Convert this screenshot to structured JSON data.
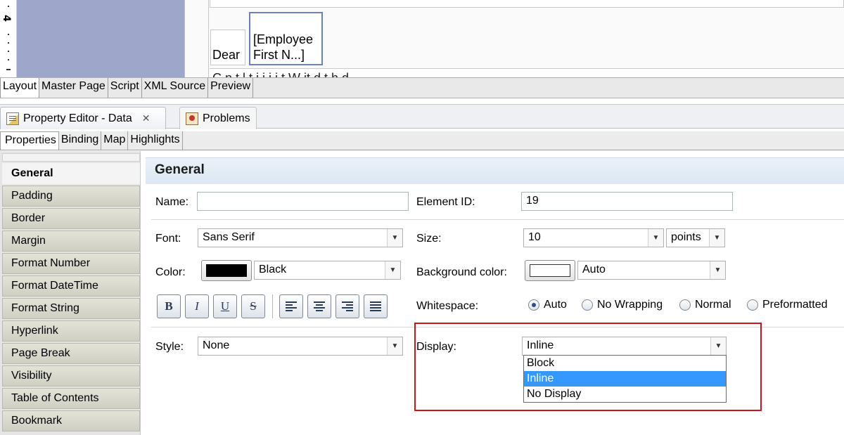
{
  "canvas": {
    "ruler_number": "4",
    "dear_text": "Dear",
    "employee_field": "[Employee\nFirst N...]",
    "cut_text": "C  n  t  l  t  i      i i i          t           W           it  d t  h       d"
  },
  "editor_tabs": [
    "Layout",
    "Master Page",
    "Script",
    "XML Source",
    "Preview"
  ],
  "view_tabs": {
    "property_editor": "Property Editor - Data",
    "close_glyph": "✕",
    "problems": "Problems"
  },
  "property_tabs": [
    "Properties",
    "Binding",
    "Map",
    "Highlights"
  ],
  "categories": [
    "General",
    "Padding",
    "Border",
    "Margin",
    "Format Number",
    "Format DateTime",
    "Format String",
    "Hyperlink",
    "Page Break",
    "Visibility",
    "Table of Contents",
    "Bookmark"
  ],
  "section_title": "General",
  "form": {
    "name_label": "Name:",
    "name_value": "",
    "element_id_label": "Element ID:",
    "element_id_value": "19",
    "font_label": "Font:",
    "font_value": "Sans Serif",
    "size_label": "Size:",
    "size_value": "10",
    "size_unit": "points",
    "color_label": "Color:",
    "color_value": "Black",
    "color_swatch": "#000000",
    "bg_color_label": "Background color:",
    "bg_color_value": "Auto",
    "bg_swatch": "#ffffff",
    "whitespace_label": "Whitespace:",
    "whitespace_options": [
      "Auto",
      "No Wrapping",
      "Normal",
      "Preformatted"
    ],
    "whitespace_selected": "Auto",
    "style_label": "Style:",
    "style_value": "None",
    "display_label": "Display:",
    "display_value": "Inline",
    "display_options": [
      "Block",
      "Inline",
      "No Display"
    ],
    "display_highlighted": "Inline"
  },
  "format_buttons": {
    "bold": "B",
    "italic": "I",
    "underline": "U",
    "strike": "S"
  },
  "colors": {
    "highlight_border": "#c8151b",
    "selected_option": "#3399ff"
  }
}
